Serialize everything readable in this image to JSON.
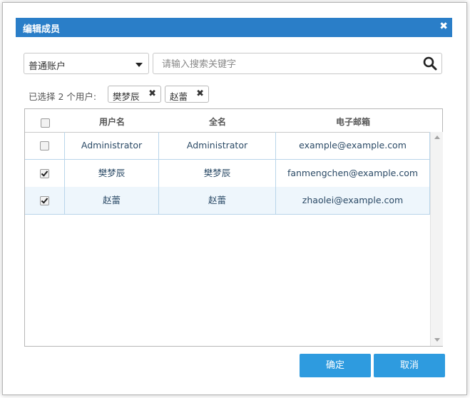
{
  "dialog": {
    "title": "编辑成员",
    "close_symbol": "✖"
  },
  "filter": {
    "account_type": "普通账户",
    "search_placeholder": "请输入搜索关键字"
  },
  "selected": {
    "label": "已选择 2 个用户:",
    "tags": [
      {
        "text": "樊梦辰",
        "remove_symbol": "✖"
      },
      {
        "text": "赵蕾",
        "remove_symbol": "✖"
      }
    ]
  },
  "table": {
    "headers": [
      "用户名",
      "全名",
      "电子邮箱"
    ],
    "rows": [
      {
        "username": "Administrator",
        "fullname": "Administrator",
        "email": "example@example.com",
        "checked": false
      },
      {
        "username": "樊梦辰",
        "fullname": "樊梦辰",
        "email": "fanmengchen@example.com",
        "checked": true
      },
      {
        "username": "赵蕾",
        "fullname": "赵蕾",
        "email": "zhaolei@example.com",
        "checked": true
      }
    ]
  },
  "buttons": {
    "ok": "确定",
    "cancel": "取消"
  },
  "colors": {
    "titlebar": "#2a7ec8",
    "button": "#2e9bdf",
    "row_border": "#b9d5ea"
  }
}
